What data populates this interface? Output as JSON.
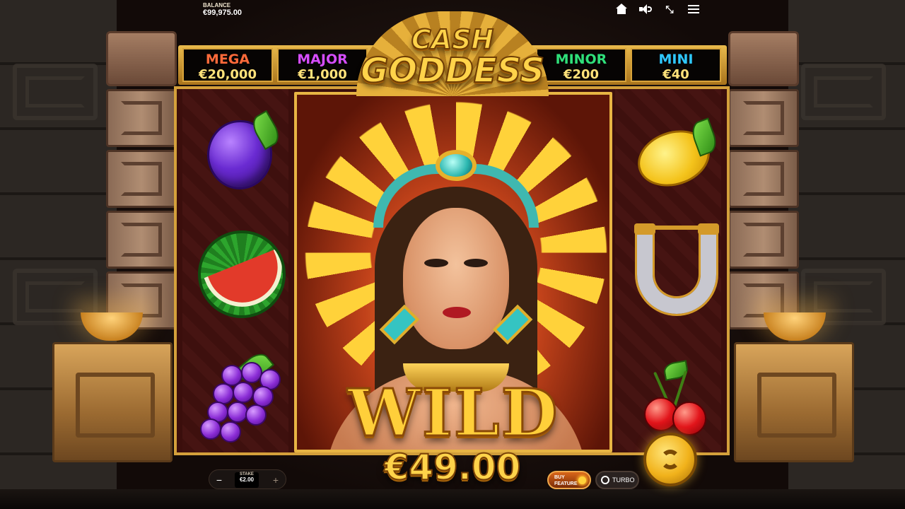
{
  "balance": {
    "label": "BALANCE",
    "value": "€99,975.00"
  },
  "logo": {
    "line1": "CASH",
    "line2": "GODDESS"
  },
  "jackpots": [
    {
      "name": "MEGA",
      "value": "€20,000",
      "color": "#ff6a3a"
    },
    {
      "name": "MAJOR",
      "value": "€1,000",
      "color": "#d64dff"
    },
    {
      "name": "MINOR",
      "value": "€200",
      "color": "#2fe07a"
    },
    {
      "name": "MINI",
      "value": "€40",
      "color": "#2fc8ff"
    }
  ],
  "top_icons": [
    "home-icon",
    "sound-icon",
    "shrink-icon",
    "menu-icon"
  ],
  "reels": {
    "reel1": [
      "plum",
      "watermelon",
      "grapes"
    ],
    "reel2_3_4": "goddess-wild",
    "reel5": [
      "lemon",
      "horseshoe",
      "cherries"
    ]
  },
  "wild": {
    "label": "WILD"
  },
  "win_amount": "€49.00",
  "stake": {
    "label": "STAKE",
    "value": "€2.00",
    "minus": "−",
    "plus": "+"
  },
  "buy_feature": {
    "line1": "BUY",
    "line2": "FEATURE"
  },
  "turbo": {
    "label": "TURBO"
  },
  "colors": {
    "gold": "#ffd34a",
    "frame": "#d4a03b",
    "reel_bg": "#3e100e"
  }
}
